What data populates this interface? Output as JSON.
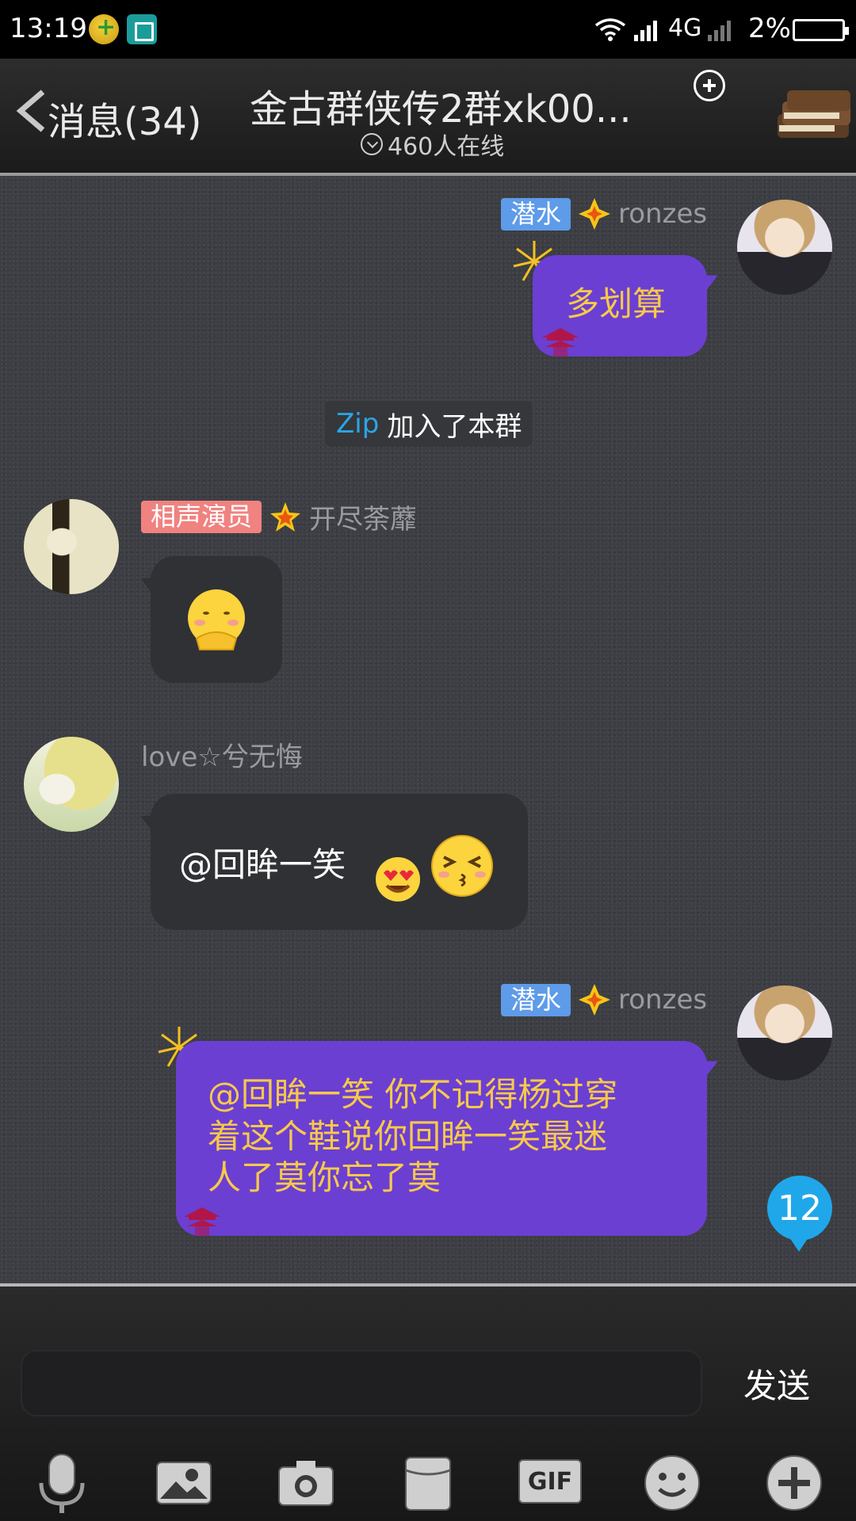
{
  "status_bar": {
    "time": "13:19",
    "network": "4G",
    "battery": "2%"
  },
  "header": {
    "back_label": "消息(34)",
    "title": "金古群侠传2群xk00...",
    "online": "460人在线"
  },
  "messages": [
    {
      "side": "right",
      "badge": "潜水",
      "name": "ronzes",
      "text": "多划算"
    },
    {
      "type": "system",
      "name": "Zip",
      "text": "加入了本群"
    },
    {
      "side": "left",
      "badge": "相声演员",
      "name": "开尽荼蘼",
      "emoji": "thinking-emoji"
    },
    {
      "side": "left",
      "name": "love☆兮无悔",
      "text": "@回眸一笑"
    },
    {
      "side": "right",
      "badge": "潜水",
      "name": "ronzes",
      "lines": [
        "@回眸一笑 你不记得杨过穿",
        "着这个鞋说你回眸一笑最迷",
        "人了莫你忘了莫"
      ]
    }
  ],
  "unread_count": "12",
  "input_bar": {
    "placeholder": "",
    "send_label": "发送",
    "tools": [
      "mic-icon",
      "image-icon",
      "camera-icon",
      "pocket-icon",
      "gif-icon",
      "emoji-icon",
      "plus-icon"
    ],
    "gif_label": "GIF"
  },
  "colors": {
    "bubble_purple": "#6b3fd2",
    "bubble_text": "#f7c94a",
    "badge_blue": "#5e9be8",
    "badge_red": "#f08280",
    "link_blue": "#2aa6e6",
    "unread": "#20a7ea"
  }
}
